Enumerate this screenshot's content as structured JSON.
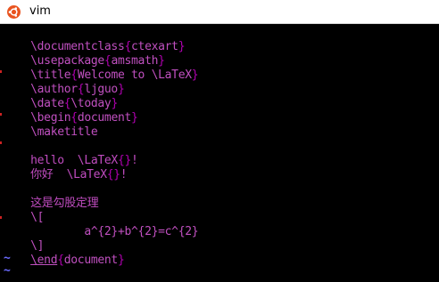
{
  "window": {
    "title": "vim",
    "icon": "ubuntu-logo-icon"
  },
  "colors": {
    "command": "#c050c0",
    "brace": "#b000b0",
    "arg": "#c050c0",
    "text": "#c04cc0",
    "tilde": "#6b6bff",
    "background": "#000000"
  },
  "buffer": {
    "lines": [
      {
        "parts": [
          "\\documentclass",
          "{",
          "ctexart",
          "}"
        ]
      },
      {
        "parts": [
          "\\usepackage",
          "{",
          "amsmath",
          "}"
        ]
      },
      {
        "parts": [
          "\\title",
          "{",
          "Welcome to \\LaTeX",
          "}"
        ]
      },
      {
        "parts": [
          "\\author",
          "{",
          "ljguo",
          "}"
        ]
      },
      {
        "parts": [
          "\\date",
          "{",
          "\\today",
          "}"
        ]
      },
      {
        "parts": [
          "\\begin",
          "{",
          "document",
          "}"
        ]
      },
      {
        "parts": [
          "\\maketitle",
          "",
          "",
          ""
        ]
      },
      {
        "parts": [
          "",
          "",
          "",
          ""
        ]
      },
      {
        "parts": [
          "hello  \\LaTeX",
          "{",
          "}",
          "!"
        ]
      },
      {
        "parts": [
          "你好  \\LaTeX",
          "{",
          "}",
          "!"
        ]
      },
      {
        "parts": [
          "",
          "",
          "",
          ""
        ]
      },
      {
        "parts": [
          "这是勾股定理",
          "",
          "",
          ""
        ]
      },
      {
        "parts": [
          "\\[",
          "",
          "",
          ""
        ]
      },
      {
        "parts": [
          "        a^{2}+b^{2}=c^{2}",
          "",
          "",
          ""
        ]
      },
      {
        "parts": [
          "\\]",
          "",
          "",
          ""
        ]
      },
      {
        "parts": [
          "\\end",
          "{",
          "document",
          "}"
        ]
      }
    ],
    "tildes": [
      "~",
      "~"
    ]
  }
}
